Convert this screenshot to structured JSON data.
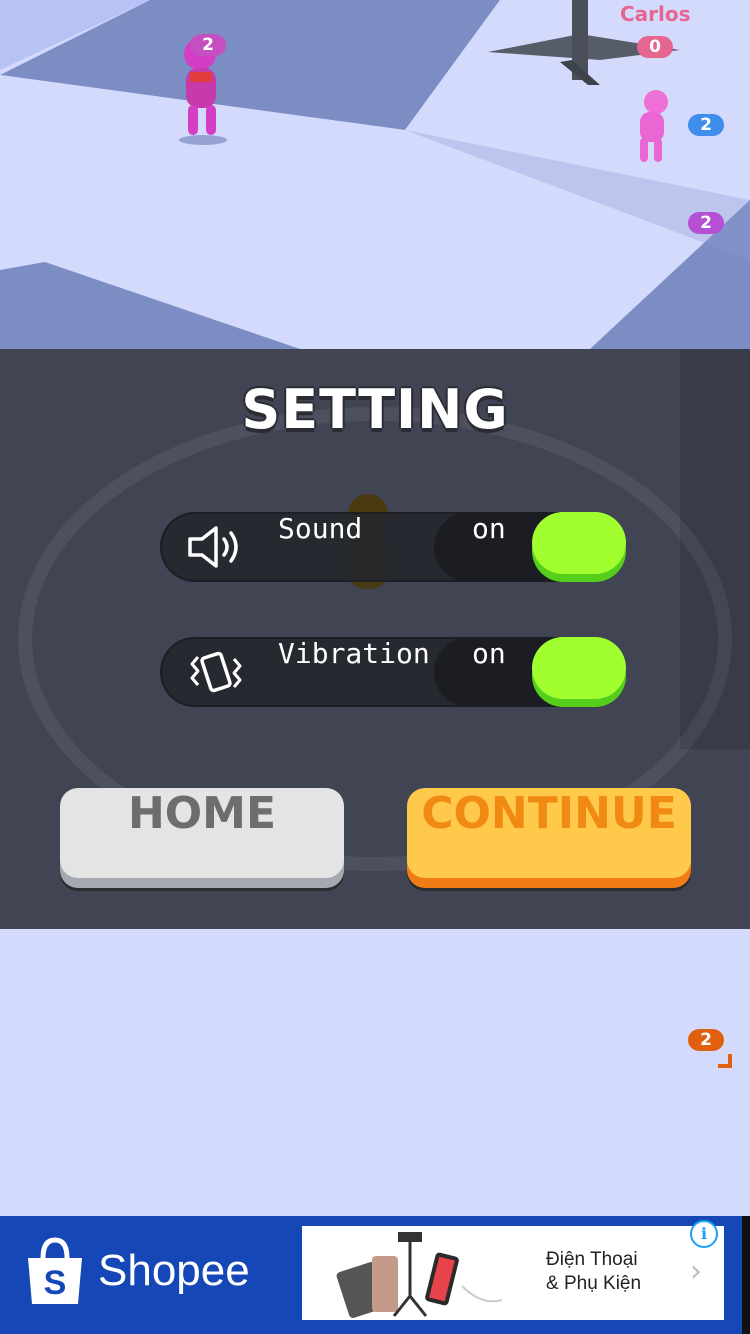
{
  "scene": {
    "opponents": [
      {
        "score": "2",
        "color": "#c54ec0"
      },
      {
        "score": "2",
        "color": "#3f8dec"
      },
      {
        "score": "2",
        "color": "#b54fd3"
      },
      {
        "score": "2",
        "color": "#e0600f"
      }
    ],
    "carlos": {
      "name": "Carlos",
      "score": "0",
      "color": "#e56790"
    }
  },
  "settings": {
    "title": "SETTING",
    "sound": {
      "label": "Sound",
      "state": "on",
      "icon": "speaker-icon"
    },
    "vibration": {
      "label": "Vibration",
      "state": "on",
      "icon": "vibration-icon"
    },
    "home_label": "HOME",
    "continue_label": "CONTINUE",
    "colors": {
      "toggle_on": "#a2ff2f",
      "continue_bg": "#ffca4b",
      "continue_text": "#f08a12",
      "home_bg": "#e4e4e4"
    }
  },
  "ad": {
    "brand": "Shopee",
    "line1": "Điện Thoại",
    "line2": "& Phụ Kiện",
    "info_glyph": "i",
    "arrow_glyph": "›",
    "bg_color": "#1547b7"
  }
}
